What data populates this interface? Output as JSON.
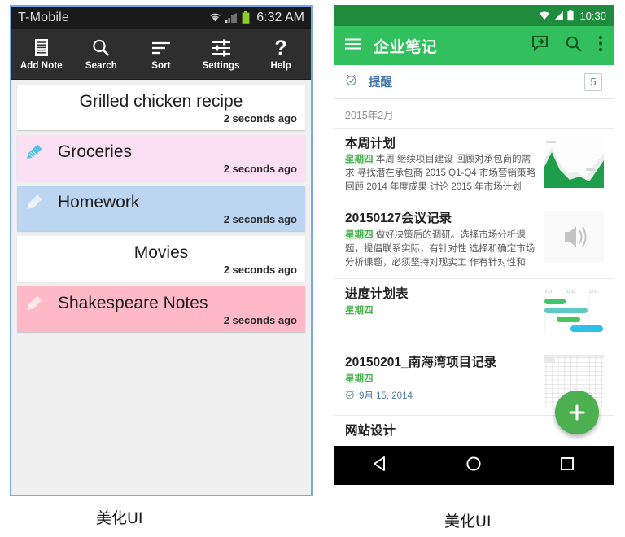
{
  "left_phone": {
    "status_bar": {
      "carrier": "T-Mobile",
      "clock": "6:32 AM",
      "icons": [
        "wifi-icon",
        "signal-icon",
        "battery-icon"
      ]
    },
    "toolbar": [
      {
        "label": "Add Note",
        "icon": "document-lines-icon"
      },
      {
        "label": "Search",
        "icon": "magnifier-icon"
      },
      {
        "label": "Sort",
        "icon": "sort-lines-icon"
      },
      {
        "label": "Settings",
        "icon": "sliders-icon"
      },
      {
        "label": "Help",
        "icon": "question-mark-icon"
      }
    ],
    "notes": [
      {
        "title": "Grilled chicken recipe",
        "time": "2 seconds ago",
        "bg": "#ffffff",
        "pencil": false,
        "centered": true
      },
      {
        "title": "Groceries",
        "time": "2 seconds ago",
        "bg": "#fbdff2",
        "pencil": true,
        "pencil_color": "#4fc3e8",
        "centered": false
      },
      {
        "title": "Homework",
        "time": "2 seconds ago",
        "bg": "#bcd6f2",
        "pencil": true,
        "pencil_color": "#e8f1fb",
        "centered": false
      },
      {
        "title": "Movies",
        "time": "2 seconds ago",
        "bg": "#ffffff",
        "pencil": false,
        "centered": true
      },
      {
        "title": "Shakespeare Notes",
        "time": "2 seconds ago",
        "bg": "#ffb8c6",
        "pencil": true,
        "pencil_color": "#fbe2e7",
        "centered": false
      }
    ],
    "caption": "美化UI"
  },
  "right_phone": {
    "status_bar": {
      "clock": "10:30",
      "icons": [
        "wifi-icon",
        "signal-icon",
        "battery-icon"
      ]
    },
    "app_bar": {
      "menu_icon": "hamburger-icon",
      "title": "企业笔记",
      "actions": [
        "share-chat-icon",
        "search-icon",
        "overflow-menu-icon"
      ]
    },
    "reminder": {
      "icon": "alarm-clock-icon",
      "label": "提醒",
      "count": "5"
    },
    "month_label": "2015年2月",
    "notes": [
      {
        "title": "本周计划",
        "weekday": "星期四",
        "body": " 本周 继续项目建设 回顾对承包商的需求  寻找潜在承包商  2015 Q1-Q4 市场营销策略 回顾 2014 年度成果 讨论 2015 年市场计划",
        "thumb": "area-chart-thumb"
      },
      {
        "title": "20150127会议记录",
        "weekday": "星期四",
        "body": " 做好决策后的调研。选择市场分析课题，提倡联系实际，有针对性 选择和确定市场分析课题，必须坚持对现实工 作有针对性和",
        "thumb": "speaker-icon-thumb"
      },
      {
        "title": "进度计划表",
        "weekday": "星期四",
        "body": "",
        "thumb": "gantt-chart-thumb",
        "gantt_labels": [
          "2:14",
          "12:16",
          "12:21"
        ]
      },
      {
        "title": "20150201_南海湾项目记录",
        "weekday": "星期四",
        "body": "",
        "date_icon": "alarm-clock-icon",
        "date": "9月 15, 2014",
        "thumb": "spreadsheet-thumb"
      },
      {
        "title": "网站设计",
        "weekday": "",
        "body": "",
        "thumb": ""
      }
    ],
    "fab": {
      "icon": "plus-icon",
      "color": "#4caf50"
    },
    "nav_bar": [
      "back-triangle-icon",
      "home-circle-icon",
      "recents-square-icon"
    ],
    "caption": "美化UI"
  }
}
